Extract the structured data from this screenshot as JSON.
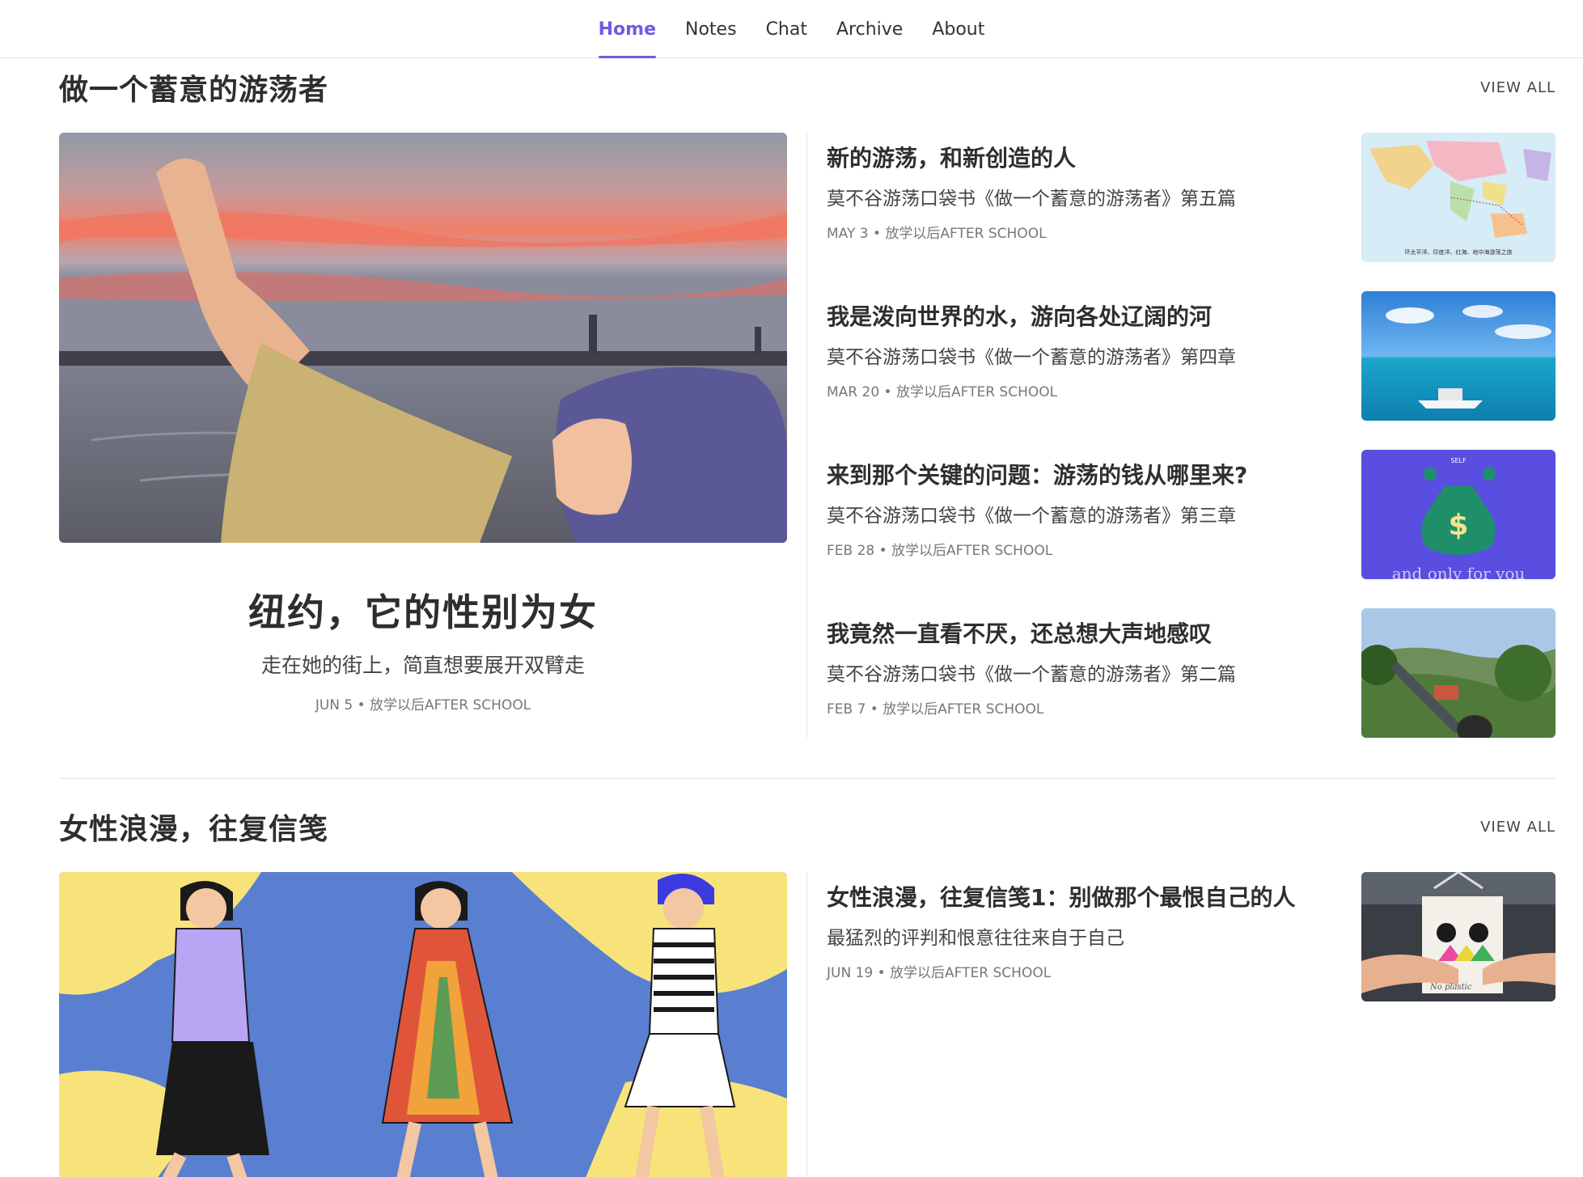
{
  "nav": {
    "items": [
      {
        "label": "Home",
        "active": true
      },
      {
        "label": "Notes",
        "active": false
      },
      {
        "label": "Chat",
        "active": false
      },
      {
        "label": "Archive",
        "active": false
      },
      {
        "label": "About",
        "active": false
      }
    ],
    "accent": "#6b5ce7"
  },
  "section1": {
    "title": "做一个蓄意的游荡者",
    "view_all": "VIEW ALL",
    "feature": {
      "title": "纽约，它的性别为女",
      "subtitle": "走在她的街上，简直想要展开双臂走",
      "meta": "JUN 5 • 放学以后AFTER SCHOOL"
    },
    "posts": [
      {
        "title": "新的游荡，和新创造的人",
        "subtitle": "莫不谷游荡口袋书《做一个蓄意的游荡者》第五篇",
        "meta": "MAY 3 • 放学以后AFTER SCHOOL",
        "map_caption": "环太平洋、印度洋、红海、地中海游荡之旅"
      },
      {
        "title": "我是泼向世界的水，游向各处辽阔的河",
        "subtitle": "莫不谷游荡口袋书《做一个蓄意的游荡者》第四章",
        "meta": "MAR 20 • 放学以后AFTER SCHOOL"
      },
      {
        "title": "来到那个关键的问题：游荡的钱从哪里来?",
        "subtitle": "莫不谷游荡口袋书《做一个蓄意的游荡者》第三章",
        "meta": "FEB 28 • 放学以后AFTER SCHOOL",
        "thumb_top_text": "SELF",
        "thumb_text": "and only for you"
      },
      {
        "title": "我竟然一直看不厌，还总想大声地感叹",
        "subtitle": "莫不谷游荡口袋书《做一个蓄意的游荡者》第二篇",
        "meta": "FEB 7 • 放学以后AFTER SCHOOL"
      }
    ]
  },
  "section2": {
    "title": "女性浪漫，往复信笺",
    "view_all": "VIEW ALL",
    "posts": [
      {
        "title": "女性浪漫，往复信笺1：别做那个最恨自己的人",
        "subtitle": "最猛烈的评判和恨意往往来自于自己",
        "meta": "JUN 19 • 放学以后AFTER SCHOOL",
        "thumb_text": "No plastic"
      }
    ]
  }
}
